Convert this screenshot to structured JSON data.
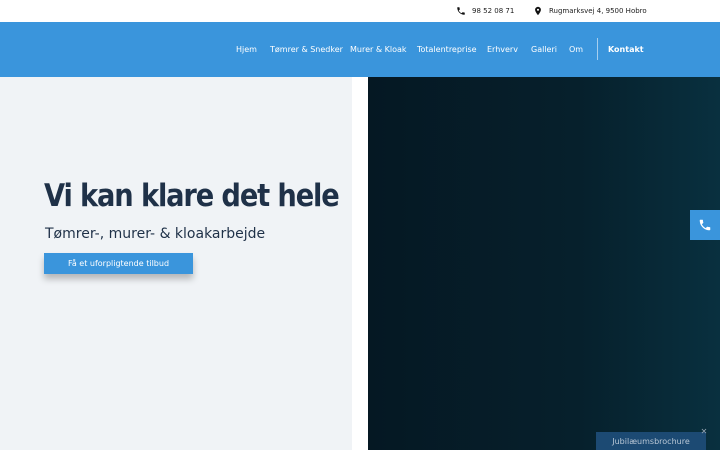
{
  "topbar": {
    "phone": "98 52 08 71",
    "address": "Rugmarksvej 4, 9500 Hobro",
    "phone_icon": "phone-icon",
    "address_icon": "map-pin-icon"
  },
  "nav": {
    "items": [
      {
        "label": "Hjem"
      },
      {
        "label": "Tømrer & Snedker"
      },
      {
        "label": "Murer & Kloak"
      },
      {
        "label": "Totalentreprise"
      },
      {
        "label": "Erhverv"
      },
      {
        "label": "Galleri"
      },
      {
        "label": "Om"
      }
    ],
    "contact": "Kontakt"
  },
  "hero": {
    "title": "Vi kan klare det hele",
    "subtitle": "Tømrer-,  murer- & kloakarbejde",
    "cta": "Få et uforpligtende tilbud"
  },
  "floating": {
    "phone_icon": "phone-icon"
  },
  "brochure": {
    "label": "Jubilæumsbrochure",
    "close": "✕"
  },
  "colors": {
    "accent": "#3a95dc",
    "heading": "#1f3148",
    "hero_bg_left": "#f0f3f6",
    "hero_bg_right": "#051823",
    "brochure_bg": "#1c4a73"
  }
}
